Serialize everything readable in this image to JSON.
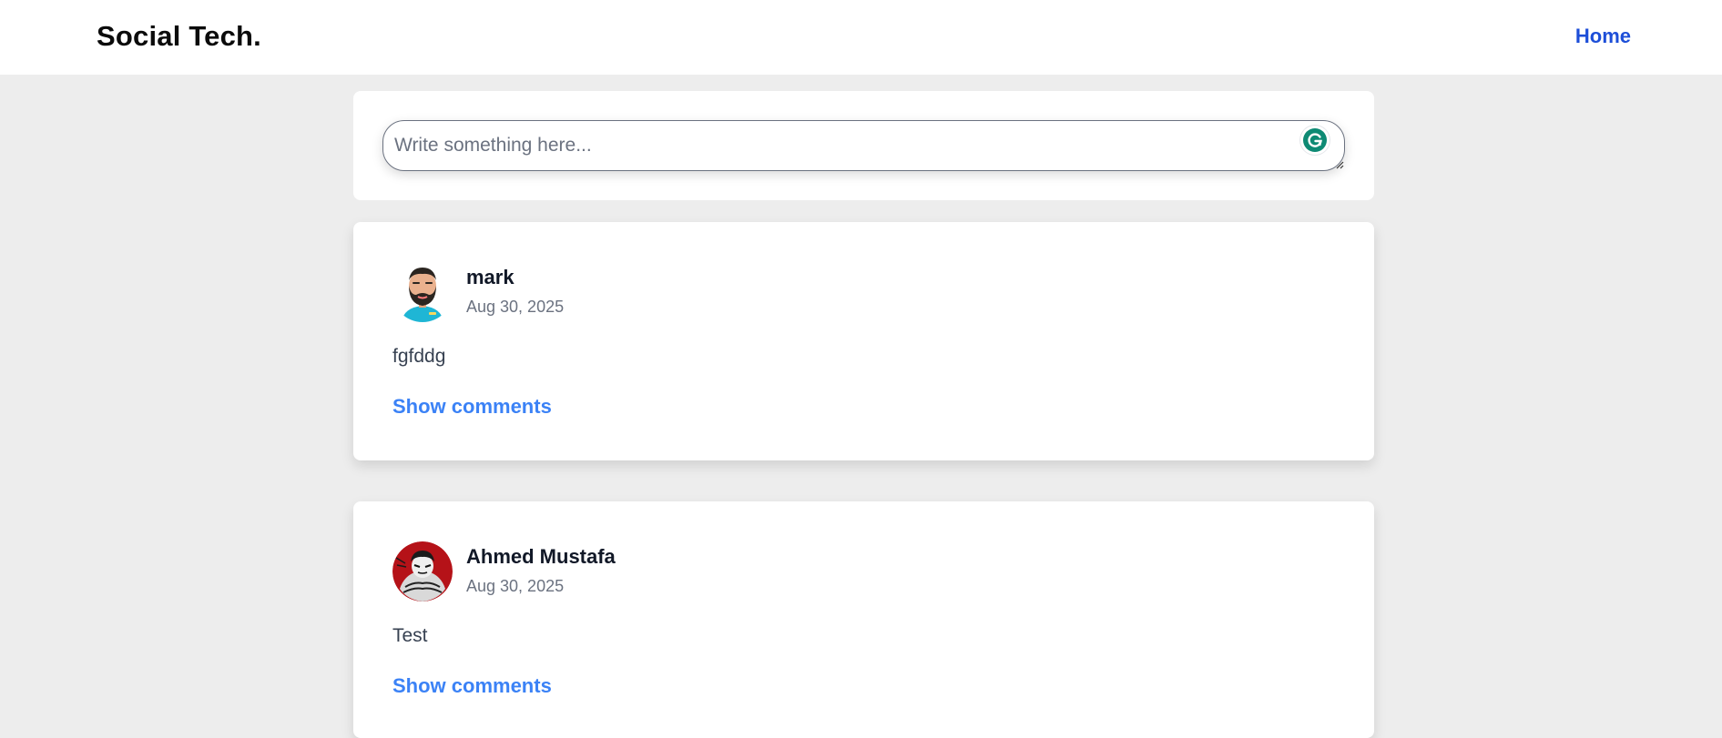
{
  "nav": {
    "brand": "Social Tech.",
    "home_label": "Home"
  },
  "composer": {
    "placeholder": "Write something here...",
    "value": "",
    "extension_badge": "G"
  },
  "posts": [
    {
      "author": "mark",
      "date": "Aug 30, 2025",
      "content": "fgfddg",
      "comments_label": "Show comments",
      "avatar_icon": "bearded-man-avatar"
    },
    {
      "author": "Ahmed Mustafa",
      "date": "Aug 30, 2025",
      "content": "Test",
      "comments_label": "Show comments",
      "avatar_icon": "manga-character-avatar"
    }
  ],
  "colors": {
    "page_bg": "#ededed",
    "nav_link": "#1d4ed8",
    "comments_link": "#3b82f6",
    "grammarly_green": "#15c39a"
  }
}
